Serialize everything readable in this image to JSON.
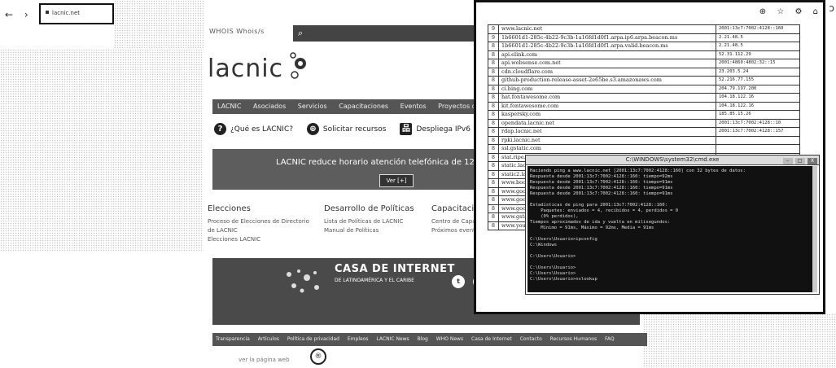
{
  "browser": {
    "back": "←",
    "forward": "›",
    "reload": "C",
    "tab_title": "lacnic.net"
  },
  "lacnic": {
    "topline": "WHOIS  Whois/s",
    "search_icon": "⌕",
    "logo_text": "lacnic",
    "nav": [
      "LACNIC",
      "Asociados",
      "Servicios",
      "Capacitaciones",
      "Eventos",
      "Proyectos de coope"
    ],
    "quick_links": [
      {
        "icon": "?",
        "label": "¿Qué es LACNIC?"
      },
      {
        "icon": "⊕",
        "label": "Solicitar recursos"
      },
      {
        "icon": "品",
        "label": "Despliega IPv6"
      }
    ],
    "banner_text": "LACNIC reduce horario atención telefónica de 12-18 UTC",
    "banner_button": "Ver [+]",
    "columns": [
      {
        "title": "Elecciones",
        "lines": [
          "Proceso de Elecciones de Directorio",
          "de LACNIC",
          "Elecciones LACNIC"
        ]
      },
      {
        "title": "Desarrollo de Políticas",
        "lines": [
          "Lista de Políticas de LACNIC",
          "Manual de Políticas"
        ]
      },
      {
        "title": "Capacitación",
        "lines": [
          "Centro de Capacitación",
          "Próximos eventos"
        ]
      }
    ],
    "footer_title": "CASA DE INTERNET",
    "footer_sub": "DE LATINOAMÉRICA Y EL CARIBE",
    "social": [
      "t",
      "f",
      "in",
      "in"
    ],
    "footer_links": [
      "Transparencia",
      "Artículos",
      "Política de privacidad",
      "Empleos",
      "LACNIC News",
      "Blog",
      "WHO News",
      "Casa de Internet",
      "Contacto",
      "Recursos Humanos",
      "FAQ"
    ],
    "bottom_text": "ver la página web",
    "bottom_icon": "®"
  },
  "overlay": {
    "toolbar_icons": [
      "⊕",
      "☆",
      "⚙",
      "⌂"
    ],
    "hosts": [
      {
        "n": "9",
        "host": "www.lacnic.net",
        "ip": "2001:13c7:7002:4128::160"
      },
      {
        "n": "9",
        "host": "1b6601d1-285c-4b22-9c3b-1a16fd1d0f1.arpa.ip6.arpa.beacon.ms",
        "ip": "2.21.48.5"
      },
      {
        "n": "8",
        "host": "1b6601d1-285c-4b22-9c3b-1a16fd1d0f1.arpa.valid.beacon.ms",
        "ip": "2.21.48.5"
      },
      {
        "n": "8",
        "host": "api.elink.com",
        "ip": "52.31.112.29"
      },
      {
        "n": "8",
        "host": "api.websense.com.net",
        "ip": "2001:4860:4802:32::15"
      },
      {
        "n": "8",
        "host": "cdn.cloudflare.com",
        "ip": "23.203.5.24"
      },
      {
        "n": "8",
        "host": "github-production-release-asset-2e65be.s3.amazonaws.com",
        "ip": "52.216.77.155"
      },
      {
        "n": "8",
        "host": "ci.bing.com",
        "ip": "204.79.197.200"
      },
      {
        "n": "8",
        "host": "hat.fontawesome.com",
        "ip": "104.18.122.16"
      },
      {
        "n": "8",
        "host": "kit.fontawesome.com",
        "ip": "104.18.122.16"
      },
      {
        "n": "8",
        "host": "kaspersky.com",
        "ip": "185.85.15.26"
      },
      {
        "n": "8",
        "host": "opendata.lacnic.net",
        "ip": "2001:13c7:7002:4128::10"
      },
      {
        "n": "8",
        "host": "rdap.lacnic.net",
        "ip": "2001:13c7:7002:4128::157"
      },
      {
        "n": "8",
        "host": "rpki.lacnic.net",
        "ip": ""
      },
      {
        "n": "8",
        "host": "ssl.gstatic.com",
        "ip": ""
      },
      {
        "n": "8",
        "host": "stat.ripe.net",
        "ip": ""
      },
      {
        "n": "8",
        "host": "static.lacnic.net",
        "ip": ""
      },
      {
        "n": "8",
        "host": "static2.lacnic.net",
        "ip": ""
      },
      {
        "n": "8",
        "host": "www.bootstrapcdn.com",
        "ip": ""
      },
      {
        "n": "8",
        "host": "www.google.com",
        "ip": ""
      },
      {
        "n": "8",
        "host": "www.google-analytics.com",
        "ip": ""
      },
      {
        "n": "8",
        "host": "www.googletagmanager.com",
        "ip": ""
      },
      {
        "n": "8",
        "host": "www.gstatic.com",
        "ip": ""
      },
      {
        "n": "8",
        "host": "www.youtube.com",
        "ip": ""
      }
    ]
  },
  "cmd": {
    "title": "C:\\WINDOWS\\system32\\cmd.exe",
    "min": "–",
    "max": "□",
    "close": "X",
    "text": "Haciendo ping a www.lacnic.net [2001:13c7:7002:4128::160] con 32 bytes de datos:\nRespuesta desde 2001:13c7:7002:4128::160: tiempo=92ms\nRespuesta desde 2001:13c7:7002:4128::160: tiempo=91ms\nRespuesta desde 2001:13c7:7002:4128::160: tiempo=91ms\nRespuesta desde 2001:13c7:7002:4128::160: tiempo=91ms\n\nEstadísticas de ping para 2001:13c7:7002:4128::160:\n    Paquetes: enviados = 4, recibidos = 4, perdidos = 0\n    (0% perdidos),\nTiempos aproximados de ida y vuelta en milisegundos:\n    Mínimo = 91ms, Máximo = 92ms, Media = 91ms\n\nC:\\Users\\Usuario>ipconfig\nC:\\Windows\n\nC:\\Users\\Usuario>\n\nC:\\Users\\Usuario>\nC:\\Users\\Usuario>\nC:\\Users\\Usuario>nslookup\n\n\nC:\\Users\\Usuario>"
  }
}
